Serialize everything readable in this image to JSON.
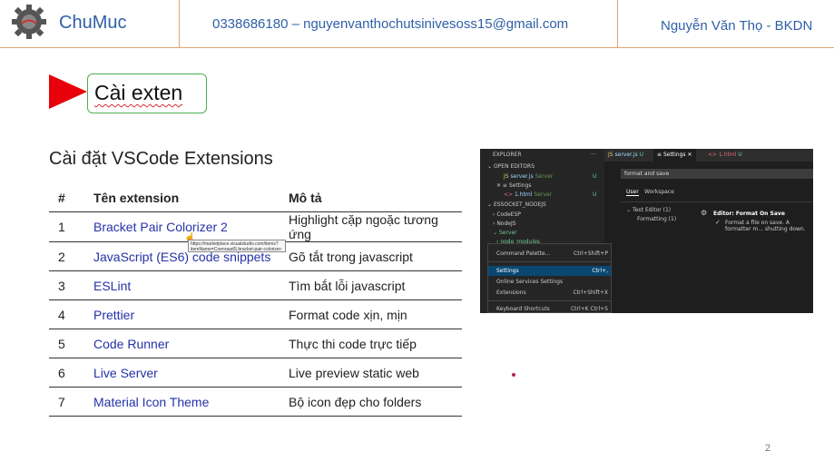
{
  "header": {
    "brand": "ChuMuc",
    "contact": "0338686180 – nguyenvanthochutsinivesoss15@gmail.com",
    "author": "Nguyễn Văn Thọ - BKDN"
  },
  "slide": {
    "title": "Cài exten",
    "section_title": "Cài đặt VSCode Extensions",
    "page_number": "2"
  },
  "table": {
    "headers": [
      "#",
      "Tên extension",
      "Mô tả"
    ],
    "rows": [
      {
        "num": "1",
        "name": "Bracket Pair Colorizer 2",
        "desc": "Highlight cặp ngoặc tương ứng"
      },
      {
        "num": "2",
        "name": "JavaScript (ES6) code snippets",
        "desc": "Gõ tắt trong javascript"
      },
      {
        "num": "3",
        "name": "ESLint",
        "desc": "Tìm bắt lỗi javascript"
      },
      {
        "num": "4",
        "name": "Prettier",
        "desc": "Format code xịn, mịn"
      },
      {
        "num": "5",
        "name": "Code Runner",
        "desc": "Thực thi code trực tiếp"
      },
      {
        "num": "6",
        "name": "Live Server",
        "desc": "Live preview static web"
      },
      {
        "num": "7",
        "name": "Material Icon Theme",
        "desc": "Bộ icon đẹp cho folders"
      }
    ],
    "tooltip": "https://marketplace.visualstudio.com/items?itemName=CoenraadS.bracket-pair-colorizer-2"
  },
  "vscode": {
    "explorer": "EXPLORER",
    "explorer_more": "···",
    "open_editors": "OPEN EDITORS",
    "open_files": [
      {
        "name": "server.js",
        "folder": "Server",
        "status": "U"
      },
      {
        "name": "Settings",
        "folder": "",
        "status": ""
      },
      {
        "name": "1.html",
        "folder": "Server",
        "status": "U"
      }
    ],
    "workspace": "ESSOCKET_NODEJS",
    "folders": [
      "CodeESP",
      "NodeJS",
      "Server",
      "node_modules"
    ],
    "tabs": [
      {
        "label": "server.js",
        "status": "U"
      },
      {
        "label": "Settings",
        "status": ""
      },
      {
        "label": "1.html",
        "status": "U"
      }
    ],
    "search_value": "format and save",
    "settings_tabs": [
      "User",
      "Workspace"
    ],
    "tree": [
      "Text Editor (1)",
      "Formatting (1)"
    ],
    "setting_title": "Editor: Format On Save",
    "setting_desc": "Format a file on save. A formatter m... shutting down.",
    "menu": [
      {
        "label": "Command Palette...",
        "key": "Ctrl+Shift+P",
        "selected": false
      },
      {
        "label": "Settings",
        "key": "Ctrl+,",
        "selected": true
      },
      {
        "label": "Online Services Settings",
        "key": "",
        "selected": false
      },
      {
        "label": "Extensions",
        "key": "Ctrl+Shift+X",
        "selected": false
      },
      {
        "label": "Keyboard Shortcuts",
        "key": "Ctrl+K Ctrl+S",
        "selected": false
      }
    ]
  },
  "colors": {
    "accent": "#2f5fa7",
    "link": "#2432a8",
    "arrow": "#e8000b",
    "header_line": "#e3a36b"
  }
}
